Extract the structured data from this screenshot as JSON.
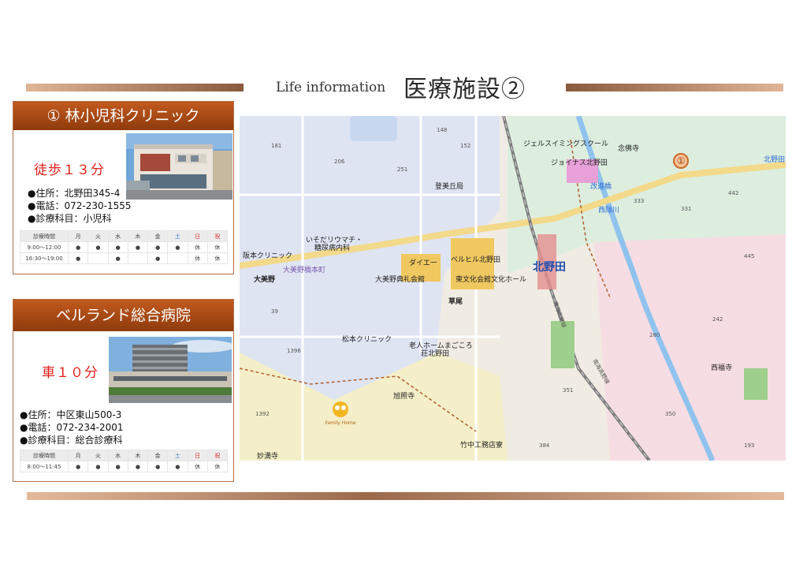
{
  "header": {
    "subtitle": "Life information",
    "title": "医療施設②"
  },
  "clinic1": {
    "title": "① 林小児科クリニック",
    "access": "徒歩１３分",
    "address": "●住所：北野田345-4",
    "phone": "●電話：072-230-1555",
    "dept": "●診療科目：小児科",
    "schedule": {
      "head": [
        "診療時間",
        "月",
        "火",
        "水",
        "木",
        "金",
        "土",
        "日",
        "祝"
      ],
      "rows": [
        [
          "9:00〜12:00",
          "●",
          "●",
          "●",
          "●",
          "●",
          "●",
          "休",
          "休"
        ],
        [
          "16:30〜19:00",
          "●",
          "",
          "●",
          "",
          "●",
          "",
          "休",
          "休"
        ]
      ]
    }
  },
  "clinic2": {
    "title": "ベルランド総合病院",
    "access": "車１０分",
    "address": "●住所：中区東山500-3",
    "phone": "●電話：072-234-2001",
    "dept": "●診療科目：総合診療科",
    "schedule": {
      "head": [
        "診療時間",
        "月",
        "火",
        "水",
        "木",
        "金",
        "土",
        "日",
        "祝"
      ],
      "rows": [
        [
          "8:00〜11:45",
          "●",
          "●",
          "●",
          "●",
          "●",
          "●",
          "休",
          "休"
        ]
      ]
    }
  },
  "map": {
    "labels": {
      "jealous": "ジェルスイミングスクール",
      "joinas": "ジョイナス北野田",
      "kaizobashi": "改進橋",
      "nishiyokawa": "西除川",
      "houenji": "念佛寺",
      "kitanoda": "北野田",
      "tomigaoka": "登美丘局",
      "isoda": "いそだリウマチ・",
      "isoda2": "糖尿病内科",
      "hanmoto": "阪本クリニック",
      "ohmino": "大美野",
      "ohminohonmachi": "大美野橋本町",
      "daiei": "ダイエー",
      "bellhill": "ベルヒル北野田",
      "bunka": "東文化会館文化ホール",
      "ohmino_hall": "大美野典礼会館",
      "kusao": "草尾",
      "matsumoto": "松本クリニック",
      "rojin": "老人ホームまごころ",
      "rojin2": "荘北野田",
      "asahiji": "旭照寺",
      "takenaka": "竹中工務店寮",
      "myokaiji": "妙満寺",
      "saifukuji": "西福寺",
      "nankai1": "南海高野線",
      "nankai2": "南海高野線",
      "family": "Family Home",
      "marker": "①"
    }
  },
  "colors": {
    "accent": "#b5582a",
    "walk": "#e0201a"
  }
}
